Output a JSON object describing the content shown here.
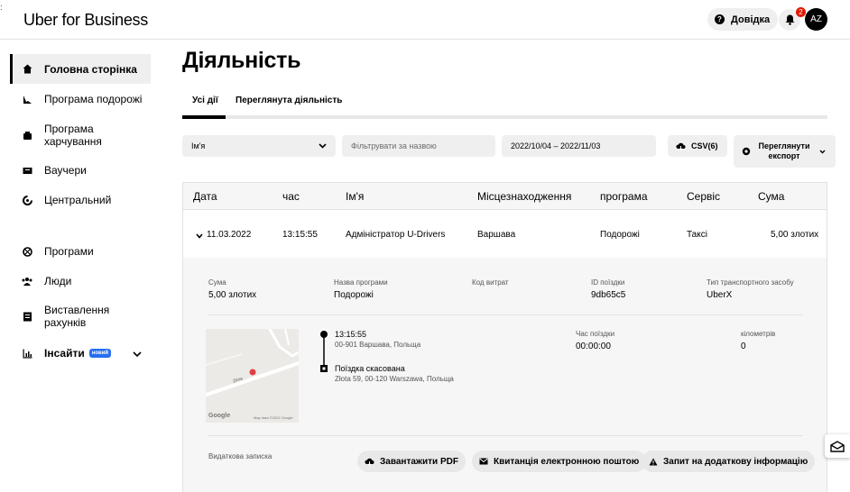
{
  "header": {
    "logo": "Uber for Business",
    "help_label": "Довідка",
    "notification_count": "2",
    "avatar_initials": "AZ"
  },
  "sidebar": {
    "items": [
      {
        "label": "Головна сторінка",
        "icon": "home-icon",
        "active": true
      },
      {
        "label": "Програма подорожі",
        "icon": "travel-icon"
      },
      {
        "label": "Програма харчування",
        "icon": "meal-icon"
      },
      {
        "label": "Ваучери",
        "icon": "voucher-icon"
      },
      {
        "label": "Центральний",
        "icon": "central-icon"
      },
      {
        "label": "Програми",
        "icon": "programs-icon"
      },
      {
        "label": "Люди",
        "icon": "people-icon"
      },
      {
        "label": "Виставлення рахунків",
        "icon": "billing-icon"
      },
      {
        "label": "Інсайти",
        "icon": "insights-icon",
        "badge": "новий"
      }
    ]
  },
  "page": {
    "title": "Діяльність",
    "tabs": [
      "Усі дії",
      "Переглянута діяльність"
    ],
    "active_tab": "Усі дії"
  },
  "filters": {
    "name_select": "Ім'я",
    "search_placeholder": "Фільтрувати за назвою",
    "date_range": "2022/10/04 – 2022/11/03",
    "csv_label": "CSV(6)",
    "export_label": "Переглянути експорт"
  },
  "table": {
    "headers": [
      "Дата",
      "час",
      "Ім'я",
      "Місцезнаходження",
      "програма",
      "Сервіс",
      "Сума"
    ],
    "row": {
      "date": "11.03.2022",
      "time": "13:15:55",
      "name": "Адміністратор U-Drivers",
      "location": "Варшава",
      "program": "Подорожі",
      "service": "Таксі",
      "amount": "5,00 злотих"
    }
  },
  "details": {
    "amount_label": "Сума",
    "amount_value": "5,00 злотих",
    "program_label": "Назва програми",
    "program_value": "Подорожі",
    "expense_code_label": "Код витрат",
    "trip_id_label": "ID поїздки",
    "trip_id_value": "9db65c5",
    "vehicle_label": "Тип транспортного засобу",
    "vehicle_value": "UberX",
    "pickup_time": "13:15:55",
    "pickup_address": "00-901 Варшава, Польща",
    "dropoff_status": "Поїздка скасована",
    "dropoff_address": "Złota 59, 00-120 Warszawa, Польща",
    "trip_time_label": "Час поїздки",
    "trip_time_value": "00:00:00",
    "km_label": "кілометрів",
    "km_value": "0",
    "note_label": "Видаткова записка",
    "map_street": "Złota",
    "map_logo": "Google",
    "map_credit": "Map data ©2022 Google",
    "actions": [
      "Завантажити PDF",
      "Квитанція електронною поштою",
      "Запит на додаткову інформацію"
    ]
  },
  "colors": {
    "accent_blue": "#276ef1",
    "badge_red": "#e11900",
    "map_pin": "#e04040"
  }
}
